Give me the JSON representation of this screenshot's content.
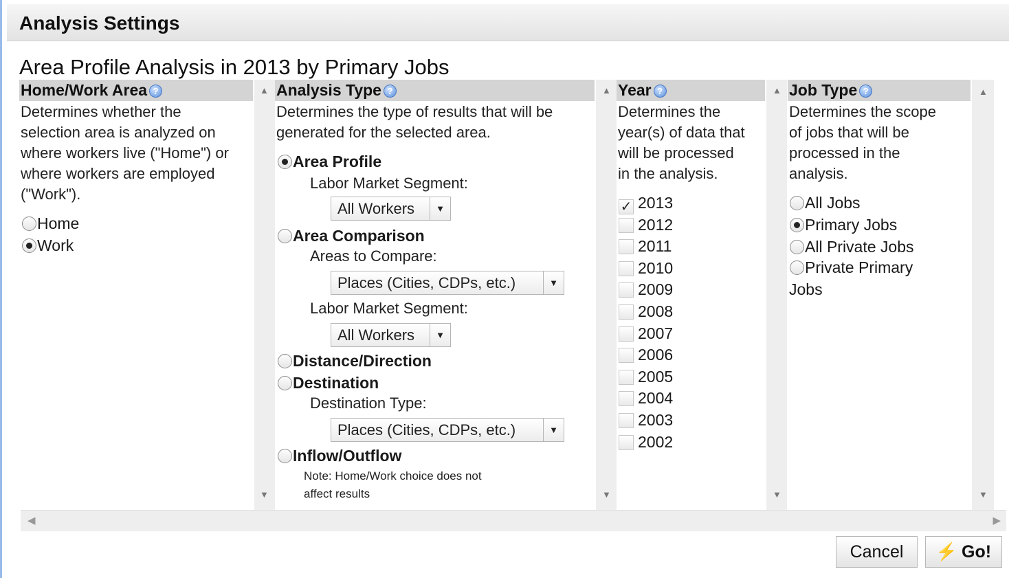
{
  "dialog": {
    "title": "Analysis Settings"
  },
  "subtitle": "Area Profile Analysis in 2013 by Primary Jobs",
  "columns": {
    "home_work": {
      "header": "Home/Work Area",
      "desc": [
        "Determines whether the",
        "selection area is analyzed on",
        "where workers live (\"Home\") or",
        "where workers are employed",
        "(\"Work\")."
      ],
      "options": [
        {
          "label": "Home",
          "selected": false
        },
        {
          "label": "Work",
          "selected": true
        }
      ]
    },
    "analysis_type": {
      "header": "Analysis Type",
      "desc": [
        "Determines the type of results that will be",
        "generated for the selected area."
      ],
      "area_profile": "Area Profile",
      "labor_market_segment_label": "Labor Market Segment:",
      "all_workers": "All Workers",
      "area_comparison": "Area Comparison",
      "areas_to_compare_label": "Areas to Compare:",
      "places": "Places (Cities, CDPs, etc.)",
      "distance_direction": "Distance/Direction",
      "destination": "Destination",
      "destination_type_label": "Destination Type:",
      "inflow_outflow": "Inflow/Outflow",
      "note": [
        "Note: Home/Work choice does not",
        "affect results"
      ]
    },
    "year": {
      "header": "Year",
      "desc": [
        "Determines the",
        "year(s) of data that",
        "will be processed",
        "in the analysis."
      ],
      "years": [
        {
          "label": "2013",
          "checked": true
        },
        {
          "label": "2012",
          "checked": false
        },
        {
          "label": "2011",
          "checked": false
        },
        {
          "label": "2010",
          "checked": false
        },
        {
          "label": "2009",
          "checked": false
        },
        {
          "label": "2008",
          "checked": false
        },
        {
          "label": "2007",
          "checked": false
        },
        {
          "label": "2006",
          "checked": false
        },
        {
          "label": "2005",
          "checked": false
        },
        {
          "label": "2004",
          "checked": false
        },
        {
          "label": "2003",
          "checked": false
        },
        {
          "label": "2002",
          "checked": false
        }
      ]
    },
    "job_type": {
      "header": "Job Type",
      "desc": [
        "Determines the scope",
        "of jobs that will be",
        "processed in the",
        "analysis."
      ],
      "options": [
        {
          "label": "All Jobs",
          "selected": false
        },
        {
          "label": "Primary Jobs",
          "selected": true
        },
        {
          "label": "All Private Jobs",
          "selected": false
        },
        {
          "label": "Private Primary",
          "selected": false
        }
      ],
      "wrap": "Jobs"
    }
  },
  "buttons": {
    "cancel": "Cancel",
    "go": "Go!"
  },
  "icons": {
    "help": "help-icon",
    "check": "✓",
    "bolt": "⚡"
  }
}
